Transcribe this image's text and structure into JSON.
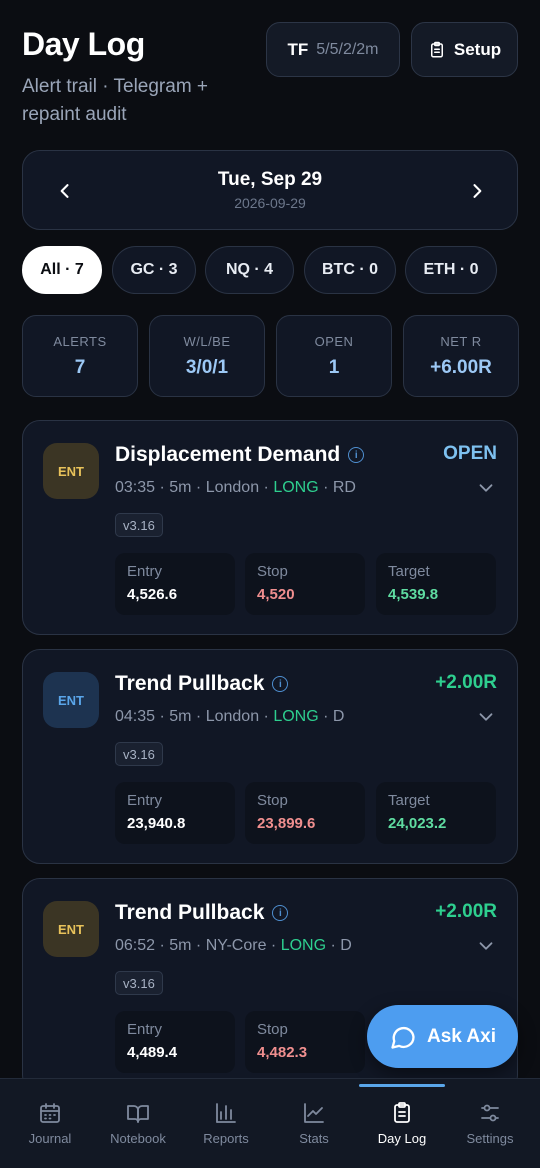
{
  "header": {
    "title": "Day Log",
    "subtitle": "Alert trail · Telegram + repaint audit",
    "tf_label": "TF",
    "tf_value": "5/5/2/2m",
    "setup_label": "Setup"
  },
  "date_nav": {
    "day": "Tue, Sep 29",
    "iso": "2026-09-29"
  },
  "filters": [
    {
      "label": "All · 7",
      "active": true
    },
    {
      "label": "GC · 3",
      "active": false
    },
    {
      "label": "NQ · 4",
      "active": false
    },
    {
      "label": "BTC · 0",
      "active": false
    },
    {
      "label": "ETH · 0",
      "active": false
    }
  ],
  "stats": [
    {
      "key": "ALERTS",
      "value": "7"
    },
    {
      "key": "W/L/BE",
      "value": "3/0/1"
    },
    {
      "key": "OPEN",
      "value": "1"
    },
    {
      "key": "NET R",
      "value": "+6.00R"
    }
  ],
  "cards": [
    {
      "badge": "ENT",
      "badge_color": "#e8c25a",
      "name": "Displacement Demand",
      "time": "03:35 · 5m · London · ",
      "direction": "LONG",
      "suffix": " · RD",
      "result": "OPEN",
      "version": "v3.16",
      "entry_label": "Entry",
      "entry": "4,526.6",
      "stop_label": "Stop",
      "stop": "4,520",
      "target_label": "Target",
      "target": "4,539.8"
    },
    {
      "badge": "ENT",
      "badge_color": "#5aa6ea",
      "name": "Trend Pullback",
      "time": "04:35 · 5m · London · ",
      "direction": "LONG",
      "suffix": " · D",
      "result": "+2.00R",
      "version": "v3.16",
      "entry_label": "Entry",
      "entry": "23,940.8",
      "stop_label": "Stop",
      "stop": "23,899.6",
      "target_label": "Target",
      "target": "24,023.2"
    },
    {
      "badge": "ENT",
      "badge_color": "#e8c25a",
      "name": "Trend Pullback",
      "time": "06:52 · 5m · NY-Core · ",
      "direction": "LONG",
      "suffix": " · D",
      "result": "+2.00R",
      "version": "v3.16",
      "entry_label": "Entry",
      "entry": "4,489.4",
      "stop_label": "Stop",
      "stop": "4,482.3"
    }
  ],
  "fab": {
    "label": "Ask Axi"
  },
  "tabs": [
    {
      "label": "Journal",
      "icon": "calendar-icon"
    },
    {
      "label": "Notebook",
      "icon": "book-icon"
    },
    {
      "label": "Reports",
      "icon": "bar-chart-icon"
    },
    {
      "label": "Stats",
      "icon": "line-chart-icon"
    },
    {
      "label": "Day Log",
      "icon": "clipboard-icon",
      "active": true
    },
    {
      "label": "Settings",
      "icon": "sliders-icon"
    }
  ]
}
